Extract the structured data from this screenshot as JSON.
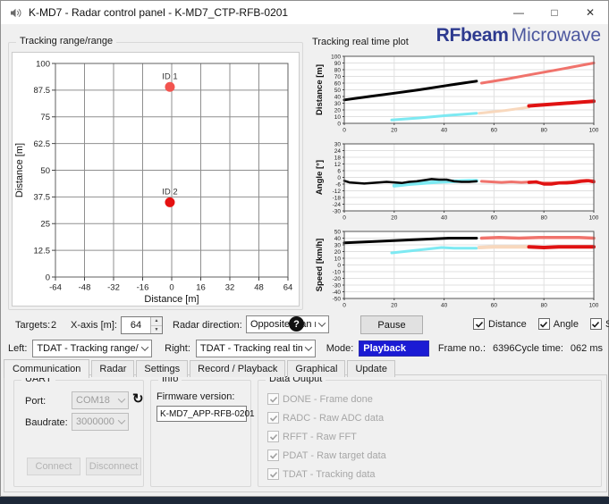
{
  "window": {
    "title": "K-MD7 - Radar control panel - K-MD7_CTP-RFB-0201",
    "minimize_glyph": "—",
    "maximize_glyph": "□",
    "close_glyph": "✕"
  },
  "logo": {
    "brand": "RFbeam",
    "suffix": "Microwave",
    "brand_color": "#2d3a8f",
    "suffix_color": "#4d589f"
  },
  "left_panel": {
    "title": "Tracking range/range"
  },
  "right_panel": {
    "title": "Tracking real time plot"
  },
  "controls": {
    "targets_label": "Targets:",
    "targets_value": "2",
    "xaxis_label": "X-axis [m]:",
    "xaxis_value": "64",
    "radar_direction_label": "Radar direction:",
    "radar_direction_value": "Opposite than monito",
    "help_glyph": "?",
    "pause_label": "Pause",
    "series_toggles": [
      {
        "label": "Distance",
        "checked": true
      },
      {
        "label": "Angle",
        "checked": true
      },
      {
        "label": "Speed",
        "checked": true
      }
    ]
  },
  "selector_row": {
    "left_label": "Left:",
    "left_value": "TDAT - Tracking range/range",
    "right_label": "Right:",
    "right_value": "TDAT - Tracking real time plot",
    "mode_label": "Mode:",
    "mode_value": "Playback",
    "mode_bg": "#1b1bd4",
    "frame_label": "Frame no.:",
    "frame_value": "6396",
    "cycle_label": "Cycle time:",
    "cycle_value": "062 ms"
  },
  "tabs": {
    "items": [
      "Communication",
      "Radar",
      "Settings",
      "Record / Playback",
      "Graphical",
      "Update"
    ],
    "active": "Communication"
  },
  "uart": {
    "title": "UART",
    "port_label": "Port:",
    "port_value": "COM18",
    "baudrate_label": "Baudrate:",
    "baudrate_value": "3000000",
    "refresh_glyph": "↻",
    "connect_label": "Connect",
    "disconnect_label": "Disconnect"
  },
  "info": {
    "title": "Info",
    "firmware_label": "Firmware version:",
    "firmware_value": "K-MD7_APP-RFB-0201"
  },
  "data_output": {
    "title": "Data Output",
    "items": [
      {
        "label": "DONE - Frame done",
        "checked": true
      },
      {
        "label": "RADC - Raw ADC data",
        "checked": true
      },
      {
        "label": "RFFT - Raw FFT",
        "checked": true
      },
      {
        "label": "PDAT - Raw target data",
        "checked": true
      },
      {
        "label": "TDAT - Tracking data",
        "checked": true
      }
    ]
  },
  "chart_data": [
    {
      "name": "tracking-range",
      "type": "scatter",
      "xlabel": "Distance [m]",
      "ylabel": "Distance [m]",
      "xlim": [
        -64,
        64
      ],
      "ylim": [
        0,
        100
      ],
      "xticks": [
        -64,
        -48,
        -32,
        -16,
        0,
        16,
        32,
        48,
        64
      ],
      "yticks": [
        0,
        12.5,
        25,
        37.5,
        50,
        62.5,
        75,
        87.5,
        100
      ],
      "grid": true,
      "points": [
        {
          "label": "ID 1",
          "x": -1,
          "y": 89,
          "color": "#f2544f"
        },
        {
          "label": "ID 2",
          "x": -1,
          "y": 35,
          "color": "#e51111"
        }
      ]
    },
    {
      "name": "distance-realtime",
      "type": "line",
      "ylabel": "Distance [m]",
      "xlim": [
        0,
        100
      ],
      "ylim": [
        0,
        100
      ],
      "xticks": [
        0,
        20,
        40,
        60,
        80,
        100
      ],
      "yticks": [
        0,
        10,
        20,
        30,
        40,
        50,
        60,
        70,
        80,
        90,
        100
      ],
      "grid": true,
      "series": [
        {
          "name": "target1-history",
          "color": "#000000",
          "width": 3,
          "points": [
            [
              0,
              35
            ],
            [
              10,
              40
            ],
            [
              20,
              45
            ],
            [
              30,
              50
            ],
            [
              42,
              57
            ],
            [
              53,
              63
            ]
          ]
        },
        {
          "name": "target1-ahead",
          "color": "#f0736c",
          "width": 3,
          "points": [
            [
              55,
              60
            ],
            [
              65,
              66
            ],
            [
              75,
              73
            ],
            [
              87,
              81
            ],
            [
              100,
              90
            ]
          ]
        },
        {
          "name": "target2-history",
          "color": "#7de9f2",
          "width": 3,
          "points": [
            [
              19,
              5
            ],
            [
              30,
              8
            ],
            [
              42,
              12
            ],
            [
              53,
              15
            ]
          ]
        },
        {
          "name": "target2-ahead-faint",
          "color": "#f8d8bd",
          "width": 3,
          "points": [
            [
              54,
              15
            ],
            [
              64,
              19
            ],
            [
              74,
              24
            ]
          ]
        },
        {
          "name": "target2-ahead",
          "color": "#e01212",
          "width": 4,
          "points": [
            [
              74,
              26
            ],
            [
              85,
              29
            ],
            [
              100,
              33
            ]
          ]
        }
      ]
    },
    {
      "name": "angle-realtime",
      "type": "line",
      "ylabel": "Angle [°]",
      "xlim": [
        0,
        100
      ],
      "ylim": [
        -30,
        30
      ],
      "xticks": [
        0,
        20,
        40,
        60,
        80,
        100
      ],
      "yticks": [
        -30,
        -24,
        -18,
        -12,
        -6,
        0,
        6,
        12,
        18,
        24,
        30
      ],
      "grid": true,
      "series": [
        {
          "name": "target2-history",
          "color": "#7de9f2",
          "width": 4,
          "points": [
            [
              20,
              -7.5
            ],
            [
              26,
              -6
            ],
            [
              32,
              -5
            ],
            [
              38,
              -4
            ],
            [
              44,
              -3.5
            ],
            [
              50,
              -3
            ],
            [
              53,
              -3
            ]
          ]
        },
        {
          "name": "target1-history",
          "color": "#000000",
          "width": 2.5,
          "points": [
            [
              0,
              -3
            ],
            [
              2,
              -4.5
            ],
            [
              5,
              -5
            ],
            [
              8,
              -5.5
            ],
            [
              11,
              -5
            ],
            [
              14,
              -4.5
            ],
            [
              17,
              -4
            ],
            [
              20,
              -4.5
            ],
            [
              23,
              -5
            ],
            [
              26,
              -4
            ],
            [
              29,
              -3.5
            ],
            [
              32,
              -2.5
            ],
            [
              35,
              -1.5
            ],
            [
              38,
              -2
            ],
            [
              41,
              -2
            ],
            [
              44,
              -3.5
            ],
            [
              47,
              -4
            ],
            [
              50,
              -4
            ],
            [
              53,
              -3.5
            ]
          ]
        },
        {
          "name": "target1-ahead",
          "color": "#f0736c",
          "width": 3,
          "points": [
            [
              55,
              -3.5
            ],
            [
              59,
              -4
            ],
            [
              63,
              -4.5
            ],
            [
              67,
              -4
            ],
            [
              71,
              -4.5
            ],
            [
              75,
              -4
            ],
            [
              79,
              -5
            ],
            [
              83,
              -5
            ],
            [
              87,
              -4.5
            ],
            [
              91,
              -4
            ],
            [
              94,
              -3
            ],
            [
              97,
              -2.5
            ],
            [
              100,
              -3
            ]
          ]
        },
        {
          "name": "target2-ahead",
          "color": "#e01212",
          "width": 3.5,
          "points": [
            [
              74,
              -4.5
            ],
            [
              77,
              -4
            ],
            [
              80,
              -6
            ],
            [
              83,
              -6
            ],
            [
              86,
              -5
            ],
            [
              89,
              -5
            ],
            [
              92,
              -4.5
            ],
            [
              95,
              -3.5
            ],
            [
              98,
              -3
            ],
            [
              100,
              -4
            ]
          ]
        }
      ]
    },
    {
      "name": "speed-realtime",
      "type": "line",
      "ylabel": "Speed [km/h]",
      "xlim": [
        0,
        100
      ],
      "ylim": [
        -50,
        50
      ],
      "xticks": [
        0,
        20,
        40,
        60,
        80,
        100
      ],
      "yticks": [
        -50,
        -40,
        -30,
        -20,
        -10,
        0,
        10,
        20,
        30,
        40,
        50
      ],
      "grid": true,
      "series": [
        {
          "name": "target1-history",
          "color": "#000000",
          "width": 3,
          "points": [
            [
              0,
              33
            ],
            [
              6,
              34
            ],
            [
              12,
              35
            ],
            [
              18,
              36
            ],
            [
              24,
              37
            ],
            [
              30,
              38
            ],
            [
              36,
              39
            ],
            [
              42,
              40
            ],
            [
              48,
              40
            ],
            [
              53,
              40
            ]
          ]
        },
        {
          "name": "target2-history",
          "color": "#7de9f2",
          "width": 3,
          "points": [
            [
              19,
              18
            ],
            [
              24,
              20
            ],
            [
              29,
              22
            ],
            [
              34,
              24
            ],
            [
              39,
              26
            ],
            [
              44,
              25
            ],
            [
              49,
              25
            ],
            [
              53,
              25
            ]
          ]
        },
        {
          "name": "target1-ahead",
          "color": "#f0736c",
          "width": 3.5,
          "points": [
            [
              55,
              40
            ],
            [
              62,
              41
            ],
            [
              70,
              40
            ],
            [
              78,
              41
            ],
            [
              86,
              41
            ],
            [
              94,
              41
            ],
            [
              100,
              40
            ]
          ]
        },
        {
          "name": "target2-ahead-faint",
          "color": "#f8d8bd",
          "width": 4,
          "points": [
            [
              54,
              26
            ],
            [
              60,
              27
            ],
            [
              67,
              27
            ],
            [
              74,
              27
            ]
          ]
        },
        {
          "name": "target2-ahead",
          "color": "#e01212",
          "width": 4,
          "points": [
            [
              74,
              27
            ],
            [
              80,
              26
            ],
            [
              86,
              27
            ],
            [
              93,
              27
            ],
            [
              100,
              27
            ]
          ]
        }
      ]
    }
  ]
}
